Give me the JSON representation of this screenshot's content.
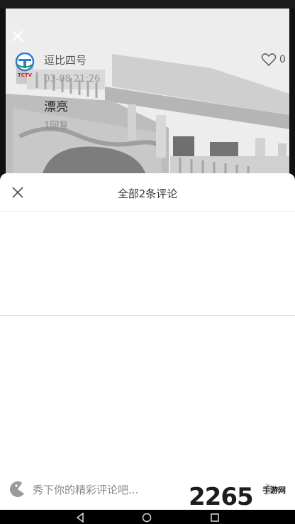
{
  "sheet": {
    "title": "全部2条评论"
  },
  "comments": [
    {
      "username": "逗比四号",
      "time": "03-08 21:26",
      "text": "漂亮",
      "replies": "1回复",
      "likes": "0",
      "avatar_label": "TCTV"
    }
  ],
  "input": {
    "placeholder": "秀下你的精彩评论吧..."
  },
  "watermark": {
    "number": "2265",
    "site": "手游网"
  },
  "colors": {
    "avatar_blue": "#2a7bd6",
    "avatar_red": "#d9252b",
    "sheet_bg": "#ffffff"
  }
}
